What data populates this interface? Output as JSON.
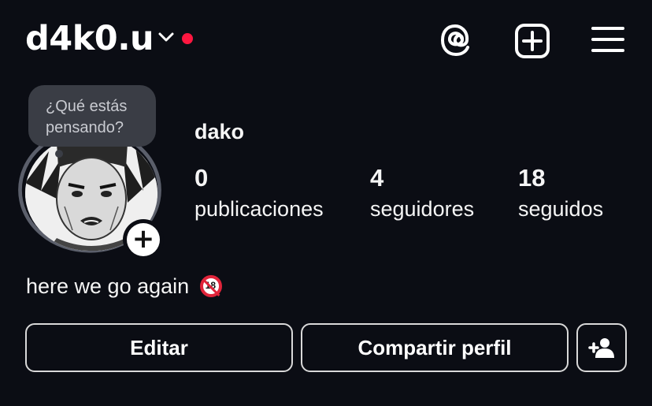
{
  "header": {
    "username": "d4k0.u",
    "icons": {
      "threads": "threads-icon",
      "create": "add-square-icon",
      "menu": "hamburger-menu-icon",
      "switch": "chevron-down-icon"
    },
    "notification_dot_color": "#ff1740"
  },
  "profile": {
    "note_bubble": "¿Qué estás pensando?",
    "note_line1": "¿Qué estás",
    "note_line2": "pensando?",
    "add_story_label": "+",
    "display_name": "dako",
    "stats": [
      {
        "value": "0",
        "label": "publicaciones"
      },
      {
        "value": "4",
        "label": "seguidores"
      },
      {
        "value": "18",
        "label": "seguidos"
      }
    ],
    "bio": "here we go again",
    "bio_emoji": "no-one-under-18-emoji"
  },
  "actions": {
    "edit_label": "Editar",
    "share_label": "Compartir perfil",
    "discover_icon": "add-person-icon"
  },
  "colors": {
    "background": "#0b0d14",
    "accent_red": "#ff1740",
    "button_border": "#d9d9d9"
  }
}
